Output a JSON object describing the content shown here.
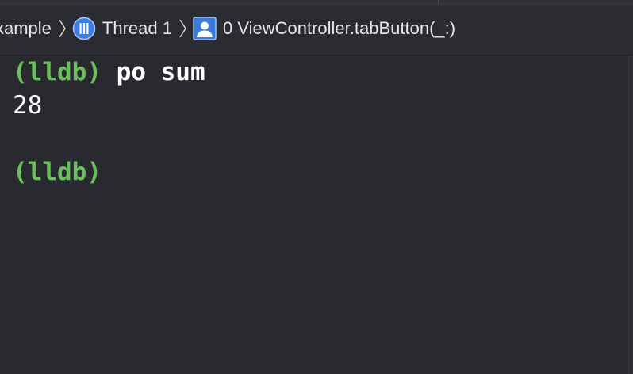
{
  "breadcrumb": {
    "items": [
      {
        "label": "xample",
        "icon": "none"
      },
      {
        "label": "Thread 1",
        "icon": "thread-icon"
      },
      {
        "label": "0 ViewController.tabButton(_:)",
        "icon": "stack-frame-user-icon"
      }
    ],
    "separator_icon": "chevron-right-icon"
  },
  "console": {
    "lines": [
      {
        "prompt": "(lldb)",
        "command": "po sum"
      },
      {
        "output": "28"
      },
      {
        "output": ""
      },
      {
        "prompt": "(lldb)",
        "command": ""
      }
    ]
  },
  "colors": {
    "background": "#292a30",
    "prompt": "#6bbf5d",
    "text": "#ffffff",
    "thread_icon": "#4d8ff0",
    "frame_icon": "#3b7fe0"
  }
}
